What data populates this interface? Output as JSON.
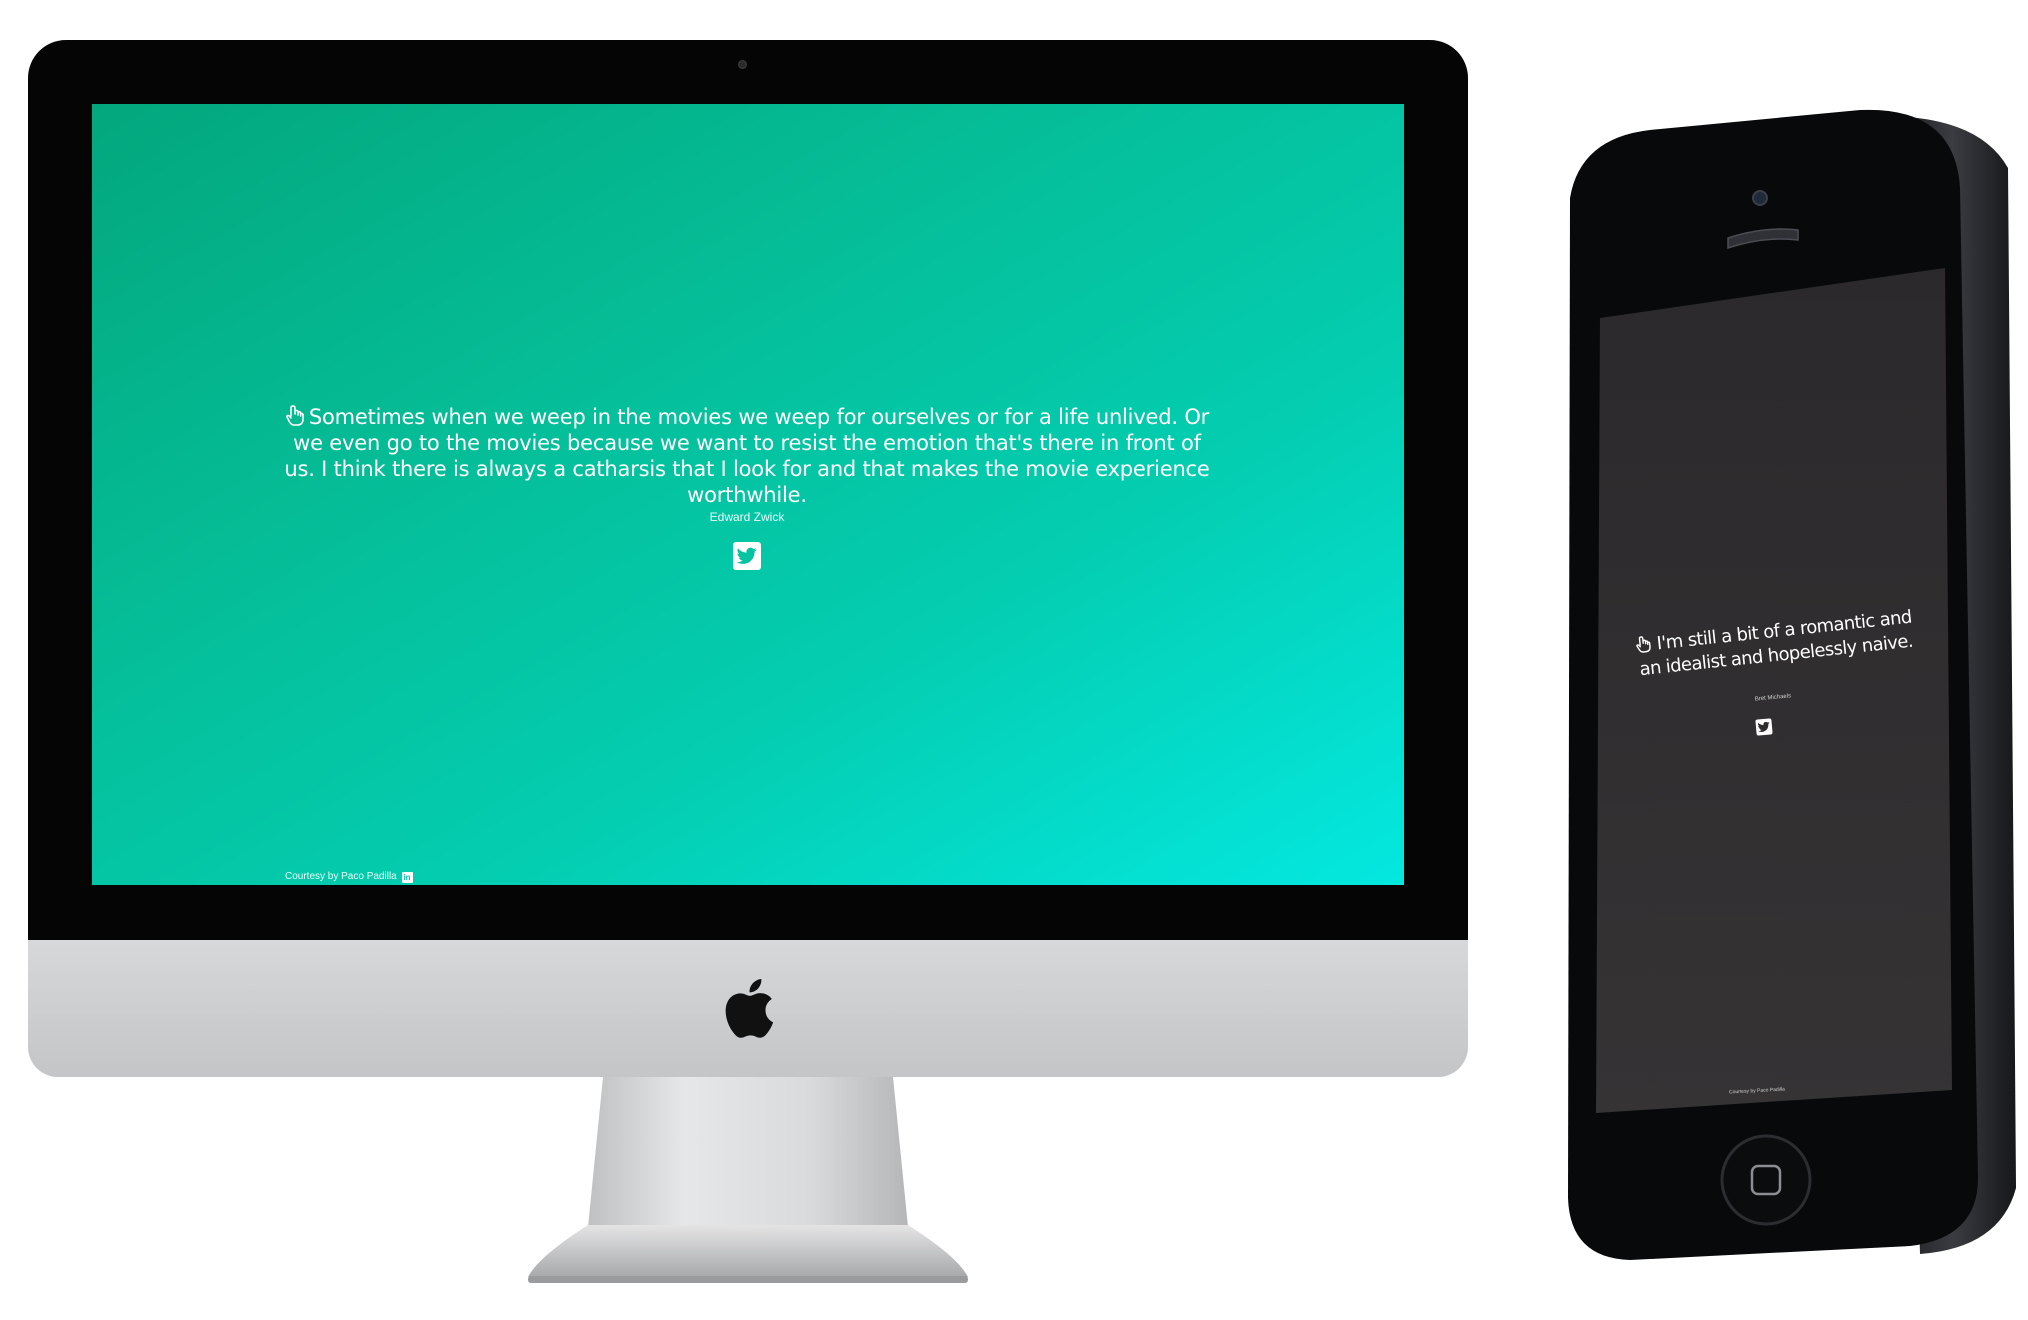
{
  "desktop": {
    "quote": "Sometimes when we weep in the movies we weep for ourselves or for a life unlived. Or we even go to the movies because we want to resist the emotion that's there in front of us. I think there is always a catharsis that I look for and that makes the movie experience worthwhile.",
    "author": "Edward Zwick",
    "courtesy": "Courtesy by Paco Padilla",
    "linkedin_label": "in",
    "colors": {
      "gradient_start": "#03a77d",
      "gradient_end": "#04e8e0"
    }
  },
  "mobile": {
    "quote": "I'm still a bit of a romantic and an idealist and hopelessly naive.",
    "author": "Bret Michaels",
    "courtesy": "Courtesy by Paco Padilla",
    "colors": {
      "screen": "#2e2c2d"
    }
  },
  "icons": {
    "quote_marker": "pointing-hand-icon",
    "share": "twitter-icon",
    "profile": "linkedin-icon",
    "brand": "apple-logo-icon"
  }
}
